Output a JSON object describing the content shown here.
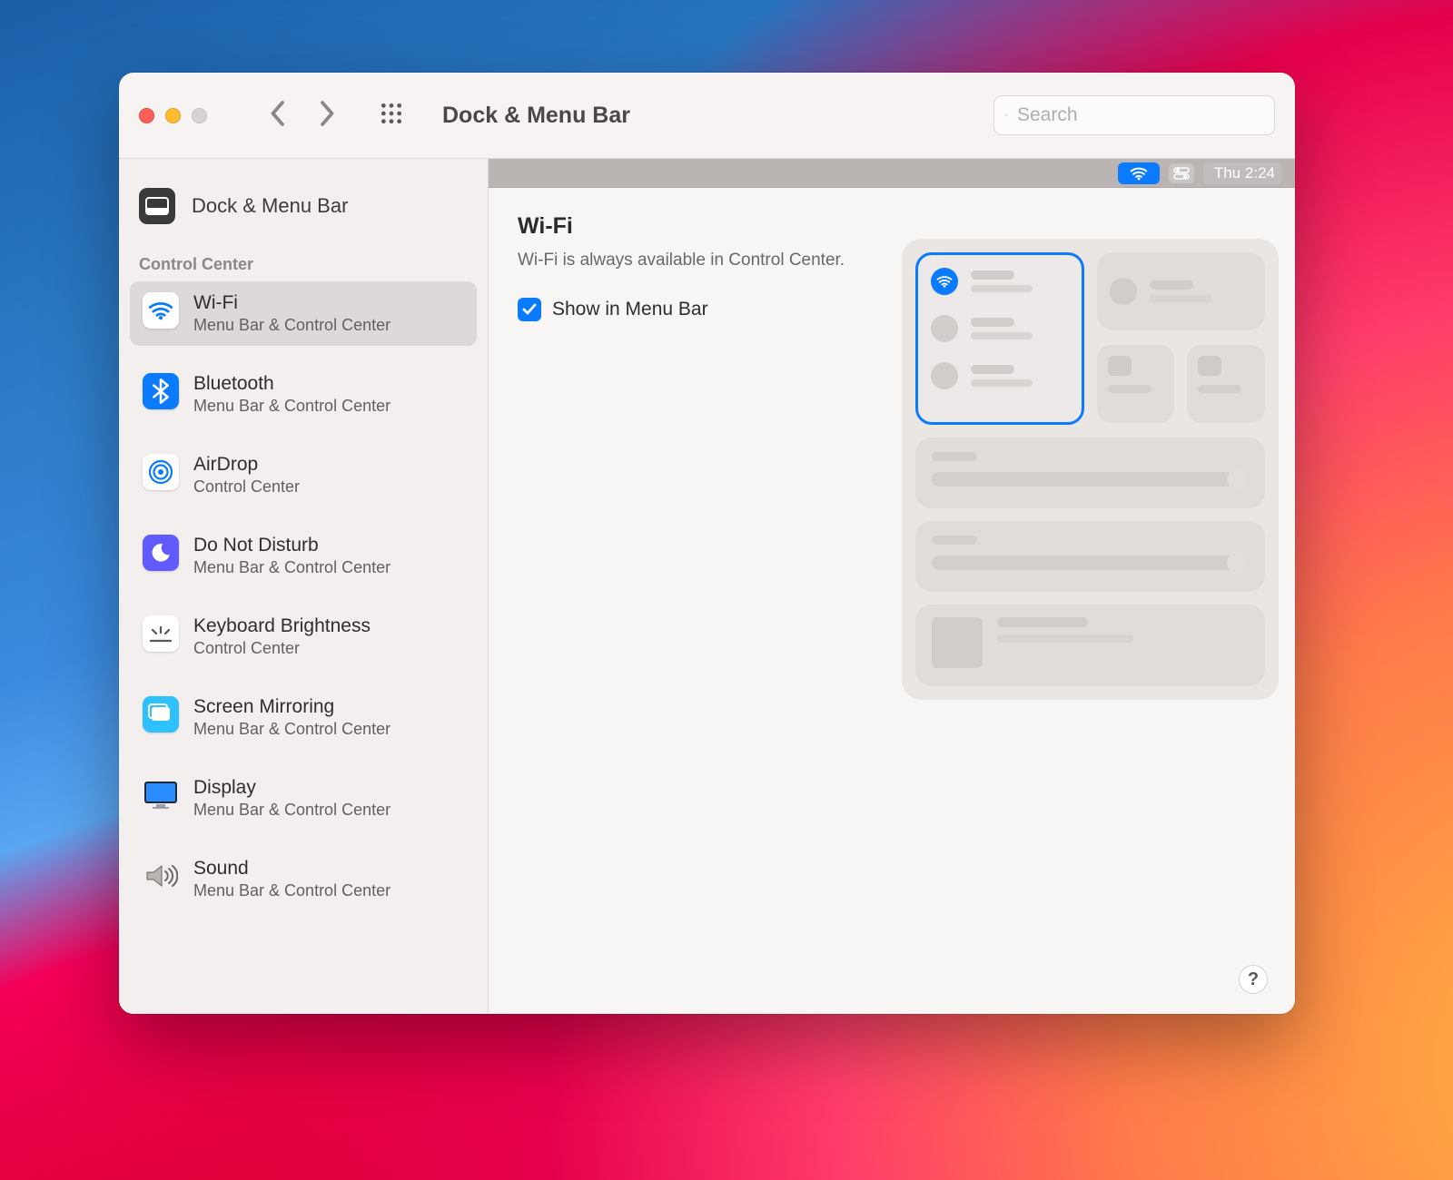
{
  "window": {
    "title": "Dock & Menu Bar"
  },
  "toolbar": {
    "search_placeholder": "Search"
  },
  "menubar_preview": {
    "time": "Thu 2:24"
  },
  "sidebar": {
    "header_label": "Dock & Menu Bar",
    "section_title": "Control Center",
    "items": [
      {
        "name": "Wi-Fi",
        "subtitle": "Menu Bar & Control Center",
        "selected": true
      },
      {
        "name": "Bluetooth",
        "subtitle": "Menu Bar & Control Center"
      },
      {
        "name": "AirDrop",
        "subtitle": "Control Center"
      },
      {
        "name": "Do Not Disturb",
        "subtitle": "Menu Bar & Control Center"
      },
      {
        "name": "Keyboard Brightness",
        "subtitle": "Control Center"
      },
      {
        "name": "Screen Mirroring",
        "subtitle": "Menu Bar & Control Center"
      },
      {
        "name": "Display",
        "subtitle": "Menu Bar & Control Center"
      },
      {
        "name": "Sound",
        "subtitle": "Menu Bar & Control Center"
      }
    ]
  },
  "detail": {
    "title": "Wi-Fi",
    "description": "Wi-Fi is always available in Control Center.",
    "checkbox_label": "Show in Menu Bar",
    "checkbox_checked": true
  },
  "help_label": "?"
}
